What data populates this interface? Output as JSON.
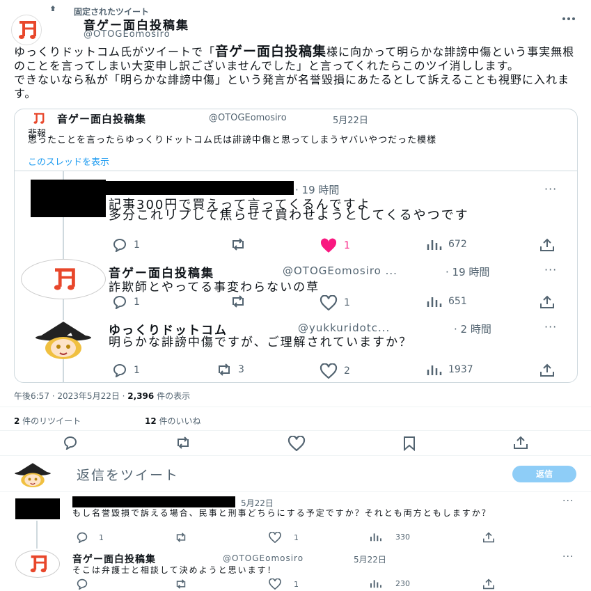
{
  "pinned_label": "固定されたツイート",
  "main": {
    "name": "音ゲー面白投稿集",
    "handle": "@OTOGEomosiro",
    "body": {
      "p1_pre": "ゆっくりドットコム氏がツイートで「",
      "p1_big": "音ゲー面白投稿集",
      "p1_post": "様に向かって明らかな誹謗中傷という事実無根のことを言ってしまい大変申し訳ございませんでした」と言ってくれたらこのツイ消しします。",
      "p2": "できないなら私が「明らかな誹謗中傷」という発言が名誉毀損にあたるとして訴えることも視野に入れます。"
    },
    "timestamp": "午後6:57 · 2023年5月22日 · ",
    "views_count": "2,396",
    "views_label": " 件の表示",
    "retweets_count": "2",
    "retweets_label": " 件のリツイート",
    "likes_count": "12",
    "likes_label": " 件のいいね"
  },
  "quote": {
    "name": "音ゲー面白投稿集",
    "handle": "@OTOGEomosiro",
    "date": "5月22日",
    "text1": "悲報",
    "text2": "思ったことを言ったらゆっくりドットコム氏は誹謗中傷と思ってしまうヤバいやつだった模様",
    "thread_link": "このスレッドを表示",
    "replies": [
      {
        "time": "· 19 時間",
        "line1": "記事300円で買えって言ってくるんですよ",
        "line2": "多分これリプして焦らせて買わせようとしてくるやつです",
        "reply": "1",
        "retweet": "",
        "like": "1",
        "views": "672"
      },
      {
        "name": "音ゲー面白投稿集",
        "handle": "@OTOGEomosiro ...",
        "time": "· 19 時間",
        "text": "詐欺師とやってる事変わらないの草",
        "reply": "1",
        "retweet": "",
        "like": "1",
        "views": "651"
      },
      {
        "name": "ゆっくりドットコム",
        "handle": "@yukkuridotc...",
        "time": "· 2 時間",
        "text": "明らかな誹謗中傷ですが、ご理解されていますか？",
        "reply": "1",
        "retweet": "3",
        "like": "2",
        "views": "1937"
      }
    ]
  },
  "composer": {
    "placeholder": "返信をツイート",
    "button": "返信"
  },
  "replies": [
    {
      "date": "5月22日",
      "text": "もし名誉毀損で訴える場合、民事と刑事どちらにする予定ですか？それとも両方ともしますか？",
      "reply": "1",
      "like": "1",
      "views": "330"
    },
    {
      "name": "音ゲー面白投稿集",
      "handle": "@OTOGEomosiro",
      "date": "5月22日",
      "text": "そこは弁護士と相談して決めようと思います！",
      "like": "1",
      "views": "230"
    }
  ],
  "colors": {
    "accent": "#1d9bf0",
    "like": "#f91880",
    "logo": "#e8472b"
  }
}
